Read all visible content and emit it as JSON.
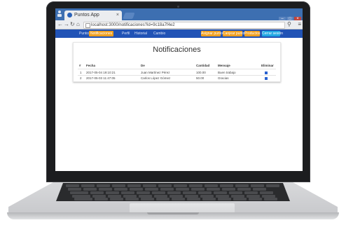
{
  "browser": {
    "tab_title": "Puntos App",
    "tab_close": "×",
    "address": "localhost:3000/notificaciones?id=9c18a7f4e2",
    "menu": "≡",
    "window_controls": [
      "–",
      "□",
      "×"
    ],
    "colors": {
      "tabbar": "#3d6fb1",
      "chrome": "#ebedf0"
    }
  },
  "navbar": {
    "links": [
      "Puntos",
      "Notificaciones",
      "Perfil",
      "Historial",
      "Cambio"
    ],
    "active_index": 1,
    "buttons": [
      {
        "label": "Asignar puntos",
        "color": "#f0a020"
      },
      {
        "label": "Canjear puntos",
        "color": "#f0a020"
      },
      {
        "label": "Productos",
        "color": "#f0a020"
      },
      {
        "label": "Cerrar sesión",
        "color": "#1fa7e3"
      }
    ],
    "background": "#2153b6"
  },
  "page": {
    "title": "Notificaciones",
    "table": {
      "headers": [
        "#",
        "Fecha",
        "De",
        "Cantidad",
        "Mensaje",
        "Eliminar"
      ],
      "rows": [
        [
          "1",
          "2017-05-04 19:10:21",
          "Juan Martínez Pérez",
          "100.00",
          "Buen trabajo",
          "delete"
        ],
        [
          "2",
          "2017-05-03 11:47:05",
          "Carlos López Gómez",
          "50.00",
          "Gracias",
          "delete"
        ]
      ]
    }
  }
}
